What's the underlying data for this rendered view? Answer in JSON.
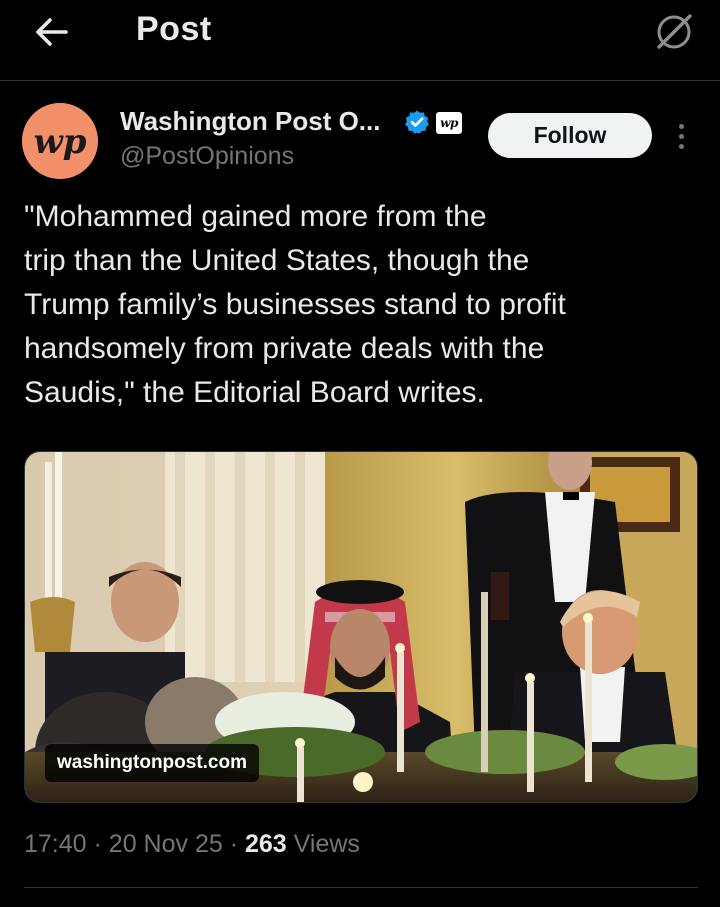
{
  "header": {
    "title": "Post",
    "back_icon": "arrow-left-icon",
    "grok_icon": "grok-icon"
  },
  "author": {
    "avatar_text": "wp",
    "name": "Washington Post O...",
    "handle": "@PostOpinions",
    "verified_icon": "verified-badge-icon",
    "affiliate_badge_text": "wp",
    "follow_label": "Follow",
    "more_icon": "more-vertical-icon"
  },
  "post": {
    "text_lines": [
      "\"Mohammed gained more from the",
      "trip than the United States, though the",
      "Trump family’s businesses stand to profit",
      "handsomely from private deals with the",
      "Saudis,\" the Editorial Board writes."
    ]
  },
  "media": {
    "link_domain": "washingtonpost.com"
  },
  "meta": {
    "time": "17:40",
    "separator": "·",
    "date": "20 Nov 25",
    "views_count": "263",
    "views_label": "Views"
  },
  "colors": {
    "background": "#000000",
    "text_primary": "#e7e9ea",
    "text_secondary": "#71767b",
    "verified_blue": "#1d9bf0",
    "avatar_bg": "#f2906a",
    "follow_bg": "#eff3f4"
  }
}
